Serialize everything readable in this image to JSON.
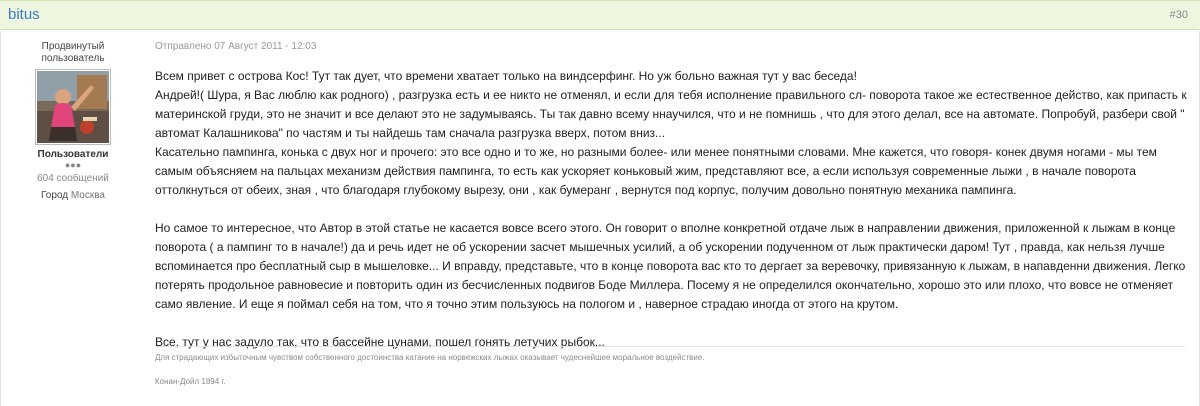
{
  "post": {
    "author_name": "bitus",
    "number": "#30",
    "date": "Отправлено 07 Август 2011 - 12:03"
  },
  "author": {
    "rank": "Продвинутый пользователь",
    "group": "Пользователи",
    "pips": "●●●",
    "post_count": "604 сообщений",
    "city_label": "Город",
    "city_value": "Москва"
  },
  "message": {
    "lines": [
      "Всем привет с острова Кос! Тут так дует, что времени хватает только на виндсерфинг. Но уж больно важная тут у вас беседа!",
      "Андрей!( Шура, я Вас люблю как родного) , разгрузка есть и ее никто не отменял, и если для тебя исполнение правильного сл- поворота такое же естественное действо, как припасть к материнской груди, это не значит и все делают это не задумываясь. Ты так давно всему ннаучился, что и не помнишь , что для этого делал, все на автомате.  Попробуй, разбери свой \" автомат Калашникова\" по частям и ты найдешь там сначала разгрузка вверх, потом вниз...",
      "  Касательно пампинга, конька с двух ног и прочего: это все одно и то же, но разными более- или менее понятными словами. Мне кажется, что говоря- конек двумя ногами - мы тем самым объясняем на пальцах механизм действия пампинга, то есть как ускоряет коньковый жим, представляют все, а если используя современные лыжи ,  в начале поворота оттолкнуться от обеих, зная , что благодаря глубокому вырезу, они , как бумеранг , вернутся  под корпус, получим довольно понятную механика пампинга.",
      "Но самое то интересное, что Автор в этой статье не касается вовсе всего этого. Он говорит о вполне конкретной отдаче лыж в направлении движения, приложенной к лыжам в конце поворота ( а пампинг то в начале!) да и речь идет не об ускорении засчет мышечных усилий, а об ускорении подученном от лыж практически даром! Тут , правда, как нельзя лучше вспоминается про бесплатный сыр в мышеловке... И вправду, представьте, что в конце поворота вас кто то дергает за веревочку, привязанную к лыжам, в напавденни движения. Легко потерять продольное равновесие и повторить один из бесчисленных подвигов Боде Миллера. Посему я не определился окончательно, хорошо это или плохо, что вовсе не отменяет само явление. И еще я поймал себя на том, что я точно этим пользуюсь на пологом и , наверное страдаю иногда от этого на крутом.",
      "Все, тут у нас задуло так, что в бассейне цунами, пошел гонять летучих рыбок..."
    ]
  },
  "signature": {
    "text": "Для страдающих избыточным чувством собственного достоинства катание на норвежских лыжах оказывает чудеснейшее моральное воздействие.",
    "author": "Конан-Дойл  1894 г."
  }
}
